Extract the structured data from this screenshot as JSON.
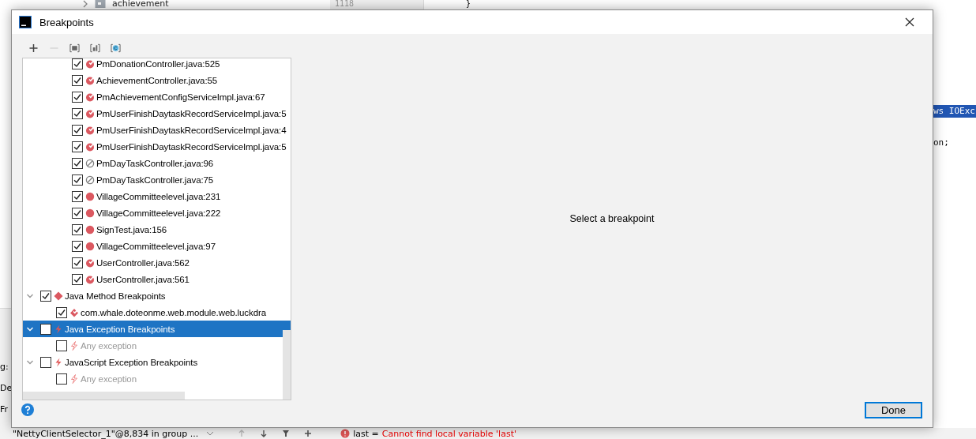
{
  "ide": {
    "project_item": "achievement",
    "line_number": "1118",
    "code_lines": [
      {
        "text": "}",
        "selected": false
      },
      {
        "text": "ws IOExc",
        "selected": true
      },
      {
        "text": "on;",
        "selected": false
      }
    ],
    "side_labels": [
      "g:",
      "De",
      "Fr"
    ],
    "thread_selector": "\"NettyClientSelector_1\"@8,834 in group ...",
    "variable": {
      "name": "last =",
      "message": "Cannot find local variable 'last'"
    }
  },
  "window": {
    "title": "Breakpoints"
  },
  "toolbar": [
    {
      "kind": "add",
      "disabled": false
    },
    {
      "kind": "remove",
      "disabled": true
    },
    {
      "kind": "group",
      "disabled": false
    },
    {
      "kind": "package",
      "disabled": false
    },
    {
      "kind": "class",
      "disabled": false
    }
  ],
  "tree": [
    {
      "children": [
        {
          "label": "PmDonationController.java:525",
          "kind": "conditional",
          "checked": true,
          "selected": false,
          "disabled": false
        },
        {
          "label": "AchievementController.java:55",
          "kind": "conditional",
          "checked": true,
          "selected": false,
          "disabled": false
        },
        {
          "label": "PmAchievementConfigServiceImpl.java:67",
          "kind": "conditional",
          "checked": true,
          "selected": false,
          "disabled": false
        },
        {
          "label": "PmUserFinishDaytaskRecordServiceImpl.java:5",
          "kind": "conditional",
          "checked": true,
          "selected": false,
          "disabled": false
        },
        {
          "label": "PmUserFinishDaytaskRecordServiceImpl.java:4",
          "kind": "conditional",
          "checked": true,
          "selected": false,
          "disabled": false
        },
        {
          "label": "PmUserFinishDaytaskRecordServiceImpl.java:5",
          "kind": "conditional",
          "checked": true,
          "selected": false,
          "disabled": false
        },
        {
          "label": "PmDayTaskController.java:96",
          "kind": "muted",
          "checked": true,
          "selected": false,
          "disabled": false
        },
        {
          "label": "PmDayTaskController.java:75",
          "kind": "muted",
          "checked": true,
          "selected": false,
          "disabled": false
        },
        {
          "label": "VillageCommitteelevel.java:231",
          "kind": "line",
          "checked": true,
          "selected": false,
          "disabled": false
        },
        {
          "label": "VillageCommitteelevel.java:222",
          "kind": "line",
          "checked": true,
          "selected": false,
          "disabled": false
        },
        {
          "label": "SignTest.java:156",
          "kind": "line",
          "checked": true,
          "selected": false,
          "disabled": false
        },
        {
          "label": "VillageCommitteelevel.java:97",
          "kind": "line",
          "checked": true,
          "selected": false,
          "disabled": false
        },
        {
          "label": "UserController.java:562",
          "kind": "conditional",
          "checked": true,
          "selected": false,
          "disabled": false
        },
        {
          "label": "UserController.java:561",
          "kind": "conditional",
          "checked": true,
          "selected": false,
          "disabled": false
        }
      ]
    },
    {
      "label": "Java Method Breakpoints",
      "kind": "method",
      "checked": true,
      "expanded": true,
      "selected": false,
      "disabled": false,
      "children": [
        {
          "label": "com.whale.doteonme.web.module.web.luckdra",
          "kind": "method-conditional",
          "checked": true,
          "selected": false,
          "disabled": false
        }
      ]
    },
    {
      "label": "Java Exception Breakpoints",
      "kind": "exception",
      "checked": false,
      "expanded": true,
      "selected": true,
      "disabled": false,
      "children": [
        {
          "label": "Any exception",
          "kind": "exception",
          "checked": false,
          "selected": false,
          "disabled": true
        }
      ]
    },
    {
      "label": "JavaScript Exception Breakpoints",
      "kind": "exception",
      "checked": false,
      "expanded": true,
      "selected": false,
      "disabled": false,
      "children": [
        {
          "label": "Any exception",
          "kind": "exception",
          "checked": false,
          "selected": false,
          "disabled": true
        }
      ]
    }
  ],
  "detail": {
    "placeholder_text": "Select a breakpoint"
  },
  "buttons": [
    {
      "label": "Done",
      "default": true
    }
  ]
}
